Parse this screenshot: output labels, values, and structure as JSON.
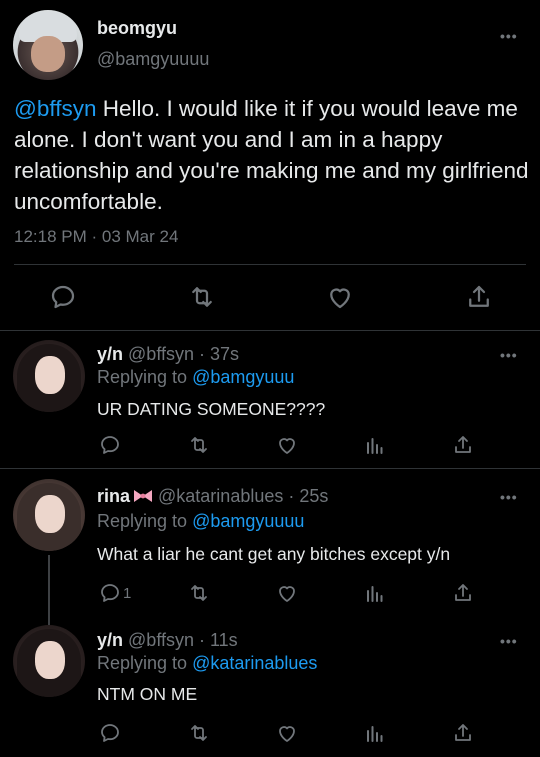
{
  "main_tweet": {
    "author_name": "beomgyu",
    "author_handle": "@bamgyuuuu",
    "mention": "@bffsyn",
    "text": " Hello. I would like it if you would leave me alone. I don't want you and I am in a happy relationship and you're making me and my girlfriend uncomfortable.",
    "timestamp": "12:18 PM · 03 Mar 24",
    "more": "•••"
  },
  "replies": [
    {
      "name": "y/n",
      "handle_time": "@bffsyn · 37s",
      "replying_prefix": "Replying to",
      "replying_to": "@bamgyuuu",
      "text": "UR DATING SOMEONE????",
      "reply_count": "",
      "more": "•••"
    },
    {
      "name": "rina",
      "handle_time": "@katarinablues · 25s",
      "replying_prefix": "Replying to",
      "replying_to": "@bamgyuuuu",
      "text": "What a liar he cant get any bitches except y/n",
      "reply_count": "1",
      "more": "•••"
    },
    {
      "name": "y/n",
      "handle_time": "@bffsyn · 11s",
      "replying_prefix": "Replying to",
      "replying_to": "@katarinablues",
      "text": "NTM ON ME",
      "reply_count": "",
      "more": "•••"
    }
  ],
  "colors": {
    "background": "#000000",
    "text": "#e7e9ea",
    "muted": "#71767b",
    "link": "#1d9bf0",
    "divider": "#2f3336",
    "bow": "#f4a7c0"
  },
  "icons": [
    "reply-icon",
    "retweet-icon",
    "like-icon",
    "analytics-icon",
    "share-icon",
    "more-icon",
    "bow-icon"
  ]
}
